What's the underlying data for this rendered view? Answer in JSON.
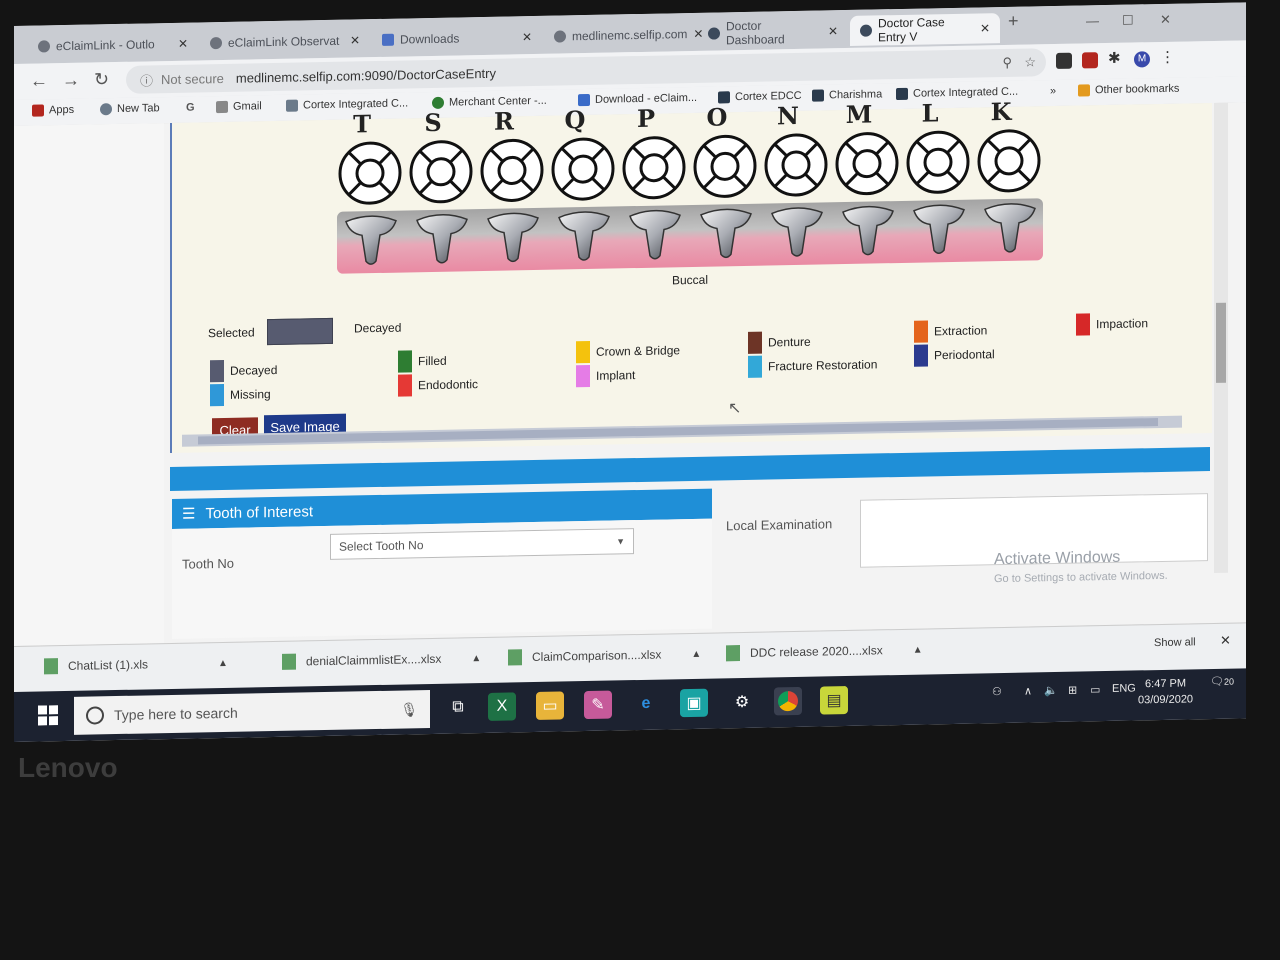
{
  "tabs": [
    {
      "label": "eClaimLink - Outlo"
    },
    {
      "label": "eClaimLink Observat"
    },
    {
      "label": "Downloads"
    },
    {
      "label": "medlinemc.selfip.com"
    },
    {
      "label": "Doctor Dashboard"
    },
    {
      "label": "Doctor Case Entry V"
    }
  ],
  "address": {
    "warning": "Not secure",
    "url": "medlinemc.selfip.com:9090/DoctorCaseEntry"
  },
  "bookmarks": [
    {
      "label": "Apps"
    },
    {
      "label": "New Tab"
    },
    {
      "label": "Gmail"
    },
    {
      "label": "Cortex Integrated C..."
    },
    {
      "label": "Merchant Center -..."
    },
    {
      "label": "Download - eClaim..."
    },
    {
      "label": "Cortex EDCC"
    },
    {
      "label": "Charishma"
    },
    {
      "label": "Cortex Integrated C..."
    },
    {
      "label": "Other bookmarks"
    }
  ],
  "teeth_letters": [
    "T",
    "S",
    "R",
    "Q",
    "P",
    "O",
    "N",
    "M",
    "L",
    "K"
  ],
  "buccal_label": "Buccal",
  "selected_label": "Selected",
  "selected_value": "Decayed",
  "legend": [
    {
      "label": "Decayed",
      "color": "#575b70"
    },
    {
      "label": "Missing",
      "color": "#2f98d8"
    },
    {
      "label": "Filled",
      "color": "#2e7d32"
    },
    {
      "label": "Endodontic",
      "color": "#e53935"
    },
    {
      "label": "Crown & Bridge",
      "color": "#f4c20d"
    },
    {
      "label": "Implant",
      "color": "#e57ce6"
    },
    {
      "label": "Denture",
      "color": "#6d3426"
    },
    {
      "label": "Fracture Restoration",
      "color": "#32a8d8"
    },
    {
      "label": "Extraction",
      "color": "#e4641c"
    },
    {
      "label": "Periodontal",
      "color": "#2b3a8f"
    },
    {
      "label": "Impaction",
      "color": "#d62828"
    }
  ],
  "buttons": {
    "clear": "Clear",
    "save_image": "Save Image"
  },
  "tooth_of_interest": {
    "title": "Tooth of Interest",
    "tooth_no_label": "Tooth No",
    "select_placeholder": "Select Tooth No",
    "local_exam_label": "Local Examination"
  },
  "activation": {
    "line1": "Activate Windows",
    "line2": "Go to Settings to activate Windows."
  },
  "downloads": [
    {
      "name": "ChatList (1).xls"
    },
    {
      "name": "denialClaimmlistEx....xlsx"
    },
    {
      "name": "ClaimComparison....xlsx"
    },
    {
      "name": "DDC release 2020....xlsx"
    }
  ],
  "downloads_show_all": "Show all",
  "taskbar": {
    "search_placeholder": "Type here to search",
    "lang": "ENG",
    "time": "6:47 PM",
    "date": "03/09/2020",
    "notifications": "20"
  },
  "bezel_logo": "Lenovo"
}
